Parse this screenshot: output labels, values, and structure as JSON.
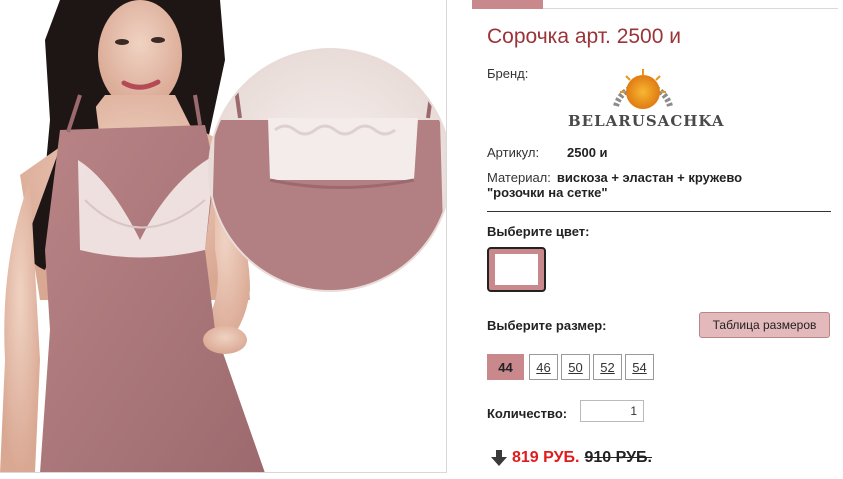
{
  "product": {
    "title": "Сорочка арт. 2500 и",
    "brand_label": "Бренд:",
    "brand_logo_text": "BELARUSACHKA",
    "article_label": "Артикул:",
    "article_value": "2500 и",
    "material_label": "Материал:",
    "material_value_line1": "вискоза + эластан + кружево",
    "material_value_line2": "\"розочки на сетке\""
  },
  "color": {
    "label": "Выберите цвет:",
    "selected_swatch_color": "#c9888c"
  },
  "size": {
    "label": "Выберите размер:",
    "chart_button": "Таблица размеров",
    "options": [
      "44",
      "46",
      "50",
      "52",
      "54"
    ],
    "selected": "44"
  },
  "quantity": {
    "label": "Количество:",
    "value": "1"
  },
  "price": {
    "current": "819 РУБ.",
    "old": "910 РУБ."
  },
  "colors": {
    "accent": "#c9888c",
    "title": "#9b3438",
    "price_new": "#e01b1b"
  },
  "icons": {
    "price_arrow": "arrow-down-icon",
    "brand_sun": "sun-logo-icon"
  }
}
